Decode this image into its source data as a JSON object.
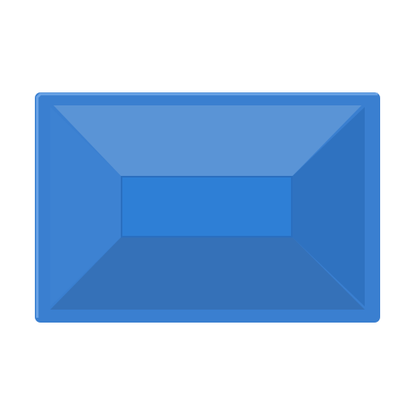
{
  "icon": {
    "name": "blue-beveled-rectangle-icon",
    "colors": {
      "background": "#ffffff",
      "outer_rim": "#3a7fd0",
      "outer_rim_highlight": "#6aa3e6",
      "top_bevel": "#5a94d6",
      "left_bevel": "#3d82d2",
      "right_bevel": "#2f72c0",
      "bottom_bevel": "#3571b8",
      "center_face": "#2e7fd6",
      "center_face_edge": "#2a6fc0"
    }
  }
}
